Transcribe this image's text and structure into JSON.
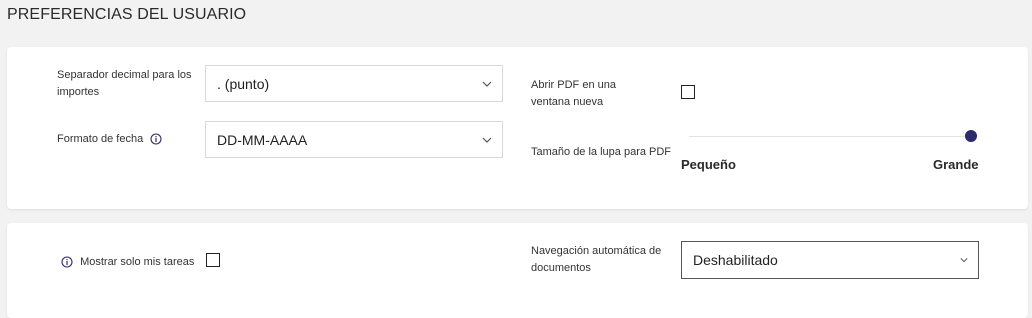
{
  "page": {
    "title": "PREFERENCIAS DEL USUARIO"
  },
  "card1": {
    "decimal_separator": {
      "label": "Separador decimal para los importes",
      "value": ". (punto)"
    },
    "date_format": {
      "label": "Formato de fecha",
      "value": "DD-MM-AAAA",
      "icon": "info-icon"
    },
    "open_pdf_new_window": {
      "label": "Abrir PDF en una ventana nueva",
      "checked": false
    },
    "pdf_zoom_size": {
      "label": "Tamaño de la lupa para PDF",
      "min_label": "Pequeño",
      "max_label": "Grande",
      "value": 1.0
    }
  },
  "card2": {
    "only_my_tasks": {
      "label": "Mostrar solo mis tareas",
      "checked": false,
      "icon": "info-icon"
    },
    "auto_navigation": {
      "label": "Navegación automática de documentos",
      "value": "Deshabilitado"
    }
  },
  "colors": {
    "accent": "#2e2a6b",
    "background": "#f2f2f2",
    "card": "#ffffff"
  }
}
